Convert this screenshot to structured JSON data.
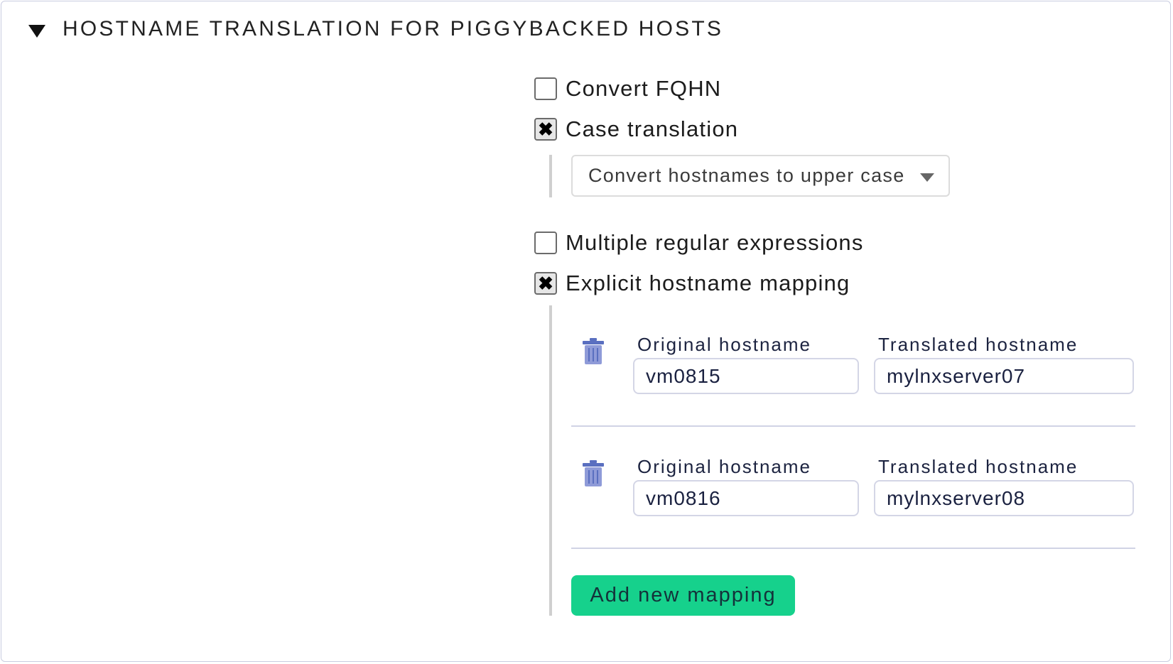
{
  "section": {
    "title": "HOSTNAME TRANSLATION FOR PIGGYBACKED HOSTS",
    "icon": "collapse-triangle-icon"
  },
  "options": {
    "convert_fqhn": {
      "label": "Convert FQHN",
      "checked": false
    },
    "case_translation": {
      "label": "Case translation",
      "checked": true,
      "selected": "Convert hostnames to upper case"
    },
    "multiple_regex": {
      "label": "Multiple regular expressions",
      "checked": false
    },
    "explicit_mapping": {
      "label": "Explicit hostname mapping",
      "checked": true
    }
  },
  "check_mark": "✖",
  "mappings": [
    {
      "original_label": "Original hostname",
      "original": "vm0815",
      "translated_label": "Translated hostname",
      "translated": "mylnxserver07"
    },
    {
      "original_label": "Original hostname",
      "original": "vm0816",
      "translated_label": "Translated hostname",
      "translated": "mylnxserver08"
    }
  ],
  "add_button": "Add new mapping",
  "colors": {
    "accent_button": "#16d18c",
    "trash_icon": "#5a6fc0"
  }
}
